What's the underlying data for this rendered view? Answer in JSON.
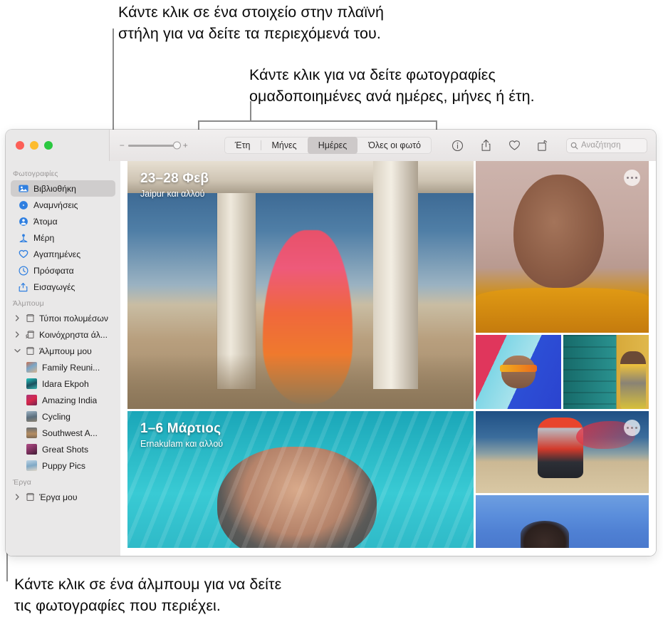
{
  "callouts": {
    "sidebar": "Κάντε κλικ σε ένα στοιχείο στην πλαϊνή\nστήλη για να δείτε τα περιεχόμενά του.",
    "group_by": "Κάντε κλικ για να δείτε φωτογραφίες\nομαδοποιημένες ανά ημέρες, μήνες ή έτη.",
    "album": "Κάντε κλικ σε ένα άλμπουμ για να δείτε\nτις φωτογραφίες που περιέχει."
  },
  "toolbar": {
    "zoom_slider": {
      "minus": "−",
      "plus": "+"
    },
    "segments": [
      {
        "label": "Έτη",
        "selected": false
      },
      {
        "label": "Μήνες",
        "selected": false
      },
      {
        "label": "Ημέρες",
        "selected": true
      },
      {
        "label": "Όλες οι φωτό",
        "selected": false
      }
    ],
    "icons": [
      "info-icon",
      "share-icon",
      "heart-icon",
      "rotate-icon"
    ],
    "search": {
      "placeholder": "Αναζήτηση"
    }
  },
  "sidebar": {
    "photos_header": "Φωτογραφίες",
    "photos_items": [
      {
        "label": "Βιβλιοθήκη",
        "icon": "library-icon",
        "selected": true
      },
      {
        "label": "Αναμνήσεις",
        "icon": "memories-icon",
        "selected": false
      },
      {
        "label": "Άτομα",
        "icon": "people-icon",
        "selected": false
      },
      {
        "label": "Μέρη",
        "icon": "places-icon",
        "selected": false
      },
      {
        "label": "Αγαπημένες",
        "icon": "favorites-heart-icon",
        "selected": false
      },
      {
        "label": "Πρόσφατα",
        "icon": "recents-clock-icon",
        "selected": false
      },
      {
        "label": "Εισαγωγές",
        "icon": "imports-icon",
        "selected": false
      }
    ],
    "albums_header": "Άλμπουμ",
    "album_trees": [
      {
        "label": "Τύποι πολυμέσων",
        "expanded": false,
        "icon": "folder-icon"
      },
      {
        "label": "Κοινόχρηστα άλ...",
        "expanded": false,
        "icon": "shared-folder-icon"
      },
      {
        "label": "Άλμπουμ μου",
        "expanded": true,
        "icon": "folder-icon"
      }
    ],
    "my_albums": [
      {
        "label": "Family Reuni...",
        "thumb": "th1"
      },
      {
        "label": "Idara Ekpoh",
        "thumb": "th2"
      },
      {
        "label": "Amazing India",
        "thumb": "th3"
      },
      {
        "label": "Cycling",
        "thumb": "th4"
      },
      {
        "label": "Southwest A...",
        "thumb": "th5"
      },
      {
        "label": "Great Shots",
        "thumb": "th6"
      },
      {
        "label": "Puppy Pics",
        "thumb": "th7"
      }
    ],
    "projects_header": "Έργα",
    "project_trees": [
      {
        "label": "Έργα μου",
        "expanded": false,
        "icon": "folder-icon"
      }
    ]
  },
  "grid": {
    "groups": [
      {
        "title": "23–28 Φεβ",
        "subtitle": "Jaipur και αλλού",
        "hero": "pavilion-dancer-photo",
        "more_badge": true
      },
      {
        "title": "1–6 Μάρτιος",
        "subtitle": "Ernakulam και αλλού",
        "hero": "pool-swimmer-photo",
        "more_badge": true
      }
    ]
  }
}
